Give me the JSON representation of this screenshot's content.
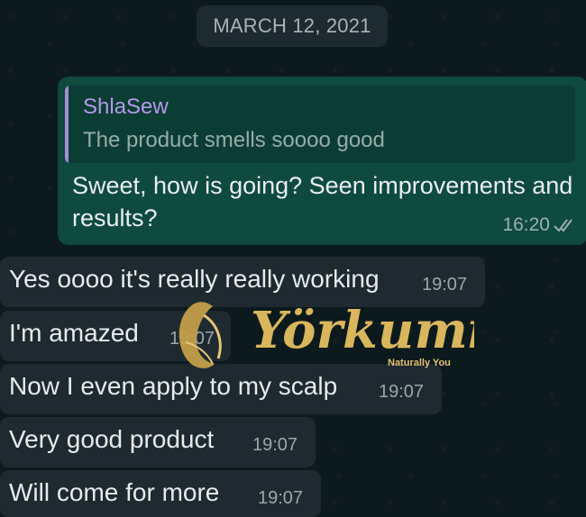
{
  "date_separator": "MARCH 12, 2021",
  "outgoing": {
    "quote_author": "ShlaSew",
    "quote_text": "The product smells soooo good",
    "text": "Sweet, how is going? Seen improvements and results?",
    "time": "16:20"
  },
  "incoming": [
    {
      "text": "Yes oooo it's really really working",
      "time": "19:07"
    },
    {
      "text": "I'm amazed",
      "time": "19:07"
    },
    {
      "text": "Now I even apply to my scalp",
      "time": "19:07"
    },
    {
      "text": "Very good product",
      "time": "19:07"
    },
    {
      "text": "Will come for more",
      "time": "19:07"
    }
  ],
  "watermark": {
    "brand": "Yörkumi",
    "tagline": "Naturally You"
  },
  "colors": {
    "outgoing_bubble": "#0f4a3f",
    "incoming_bubble": "#1e2a2f",
    "quote_bar": "#a78bd6",
    "watermark_gold": "#c8a24a"
  }
}
